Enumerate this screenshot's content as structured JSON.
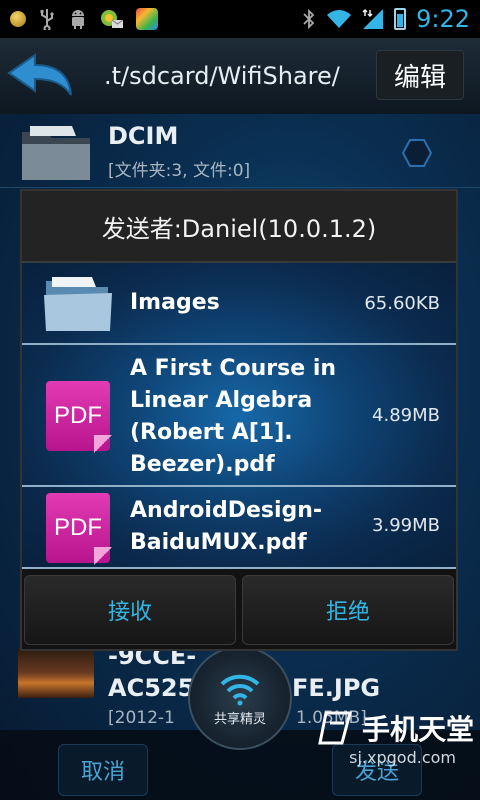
{
  "status_bar": {
    "time": "9:22",
    "icons": [
      "coin-icon",
      "usb-icon",
      "android-debug-icon",
      "app-notification-icon",
      "app-icon",
      "bluetooth-icon",
      "wifi-signal-icon",
      "cell-signal-icon",
      "battery-icon"
    ]
  },
  "toolbar": {
    "path": ".t/sdcard/WifiShare/",
    "edit_label": "编辑"
  },
  "background_list": {
    "first_item": {
      "title": "DCIM",
      "subtitle": "[文件夹:3, 文件:0]"
    },
    "last_item": {
      "title_line1": "-9CCE-",
      "title_line2": "AC52598",
      "title_suffix": "FE.JPG",
      "subtitle_left": "[2012-1",
      "subtitle_right": "1.05MB]"
    }
  },
  "bottom_bar": {
    "cancel_label": "取消",
    "send_label": "发送",
    "share_label": "共享精灵"
  },
  "watermark": {
    "brand": "手机天堂",
    "site": "sj.xpgod.com"
  },
  "dialog": {
    "title": "发送者:Daniel(10.0.1.2)",
    "files": [
      {
        "name": "Images",
        "size": "65.60KB",
        "icon": "folder-icon"
      },
      {
        "name": "A First Course in Linear Algebra (Robert A[1]. Beezer).pdf",
        "size": "4.89MB",
        "icon": "pdf-icon"
      },
      {
        "name": "AndroidDesign-BaiduMUX.pdf",
        "size": "3.99MB",
        "icon": "pdf-icon"
      }
    ],
    "pdf_label": "PDF",
    "accept_label": "接收",
    "reject_label": "拒绝"
  },
  "colors": {
    "accent": "#33b5e5",
    "pdf": "#d12aa8"
  }
}
